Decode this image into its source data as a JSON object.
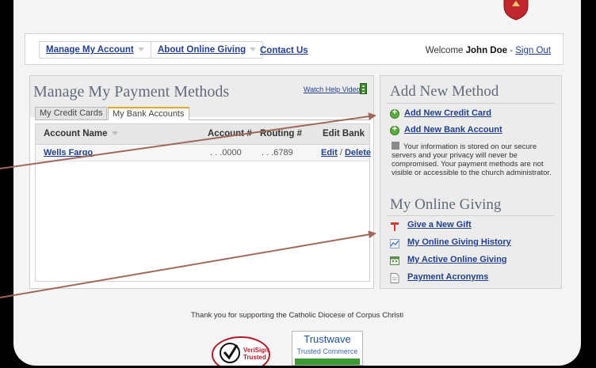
{
  "nav": {
    "manage_account": "Manage My Account",
    "about_giving": "About Online Giving",
    "contact_us": "Contact Us",
    "welcome_prefix": "Welcome ",
    "user_name": "John Doe",
    "separator": " - ",
    "sign_out": "Sign Out"
  },
  "payment": {
    "title": "Manage My Payment Methods",
    "help_video": "Watch Help Video!",
    "tabs": [
      "My Credit Cards",
      "My Bank Accounts"
    ],
    "active_tab": "My Bank Accounts",
    "columns": [
      "Account Name",
      "Account #",
      "Routing #",
      "Edit Bank"
    ],
    "rows": [
      {
        "account_name": "Wells Fargo",
        "account_num": ". . .0000",
        "routing_num": ". . .6789",
        "edit": "Edit",
        "slash": "/",
        "delete": "Delete"
      }
    ]
  },
  "add_method": {
    "title": "Add New Method",
    "add_credit_card": "Add New Credit Card",
    "add_bank_account": "Add New Bank Account",
    "privacy_note": "Your information is stored on our secure servers and your privacy will never be compromised. Your payment methods are not visible or accessible to the church administrator."
  },
  "online_giving": {
    "title": "My Online Giving",
    "links": [
      "Give a New Gift",
      "My Online Giving History",
      "My Active Online Giving",
      "Payment Acronyms"
    ]
  },
  "footer": {
    "thanks": "Thank you for supporting the Catholic Diocese of Corpus Christi",
    "verisign_line1": "VeriSign",
    "verisign_line2": "Trusted",
    "trustwave_brand": "Trustwave",
    "trustwave_sub": "Trusted Commerce"
  },
  "colors": {
    "link": "#223f8a",
    "panel_title": "#5f6b7a",
    "tab_accent": "#e8a52a",
    "annotation_arrow": "#a0675a"
  }
}
